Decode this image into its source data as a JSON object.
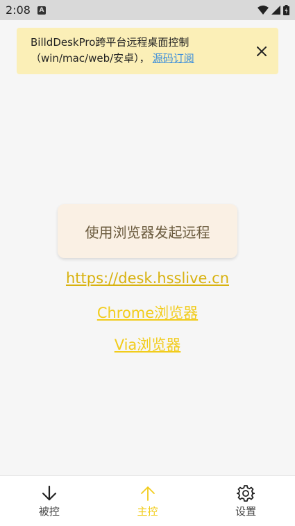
{
  "status_bar": {
    "time": "2:08",
    "app_icon_letter": "A"
  },
  "notice": {
    "text": "BilldDeskPro跨平台远程桌面控制（win/mac/web/安卓），",
    "link_text": "源码订阅"
  },
  "main": {
    "start_button_label": "使用浏览器发起远程",
    "links": [
      "https://desk.hsslive.cn",
      "Chrome浏览器",
      "Via浏览器"
    ]
  },
  "bottom_nav": {
    "items": [
      {
        "label": "被控",
        "icon": "arrow-down-icon"
      },
      {
        "label": "主控",
        "icon": "arrow-up-icon"
      },
      {
        "label": "设置",
        "icon": "gear-icon"
      }
    ],
    "active_index": 1
  },
  "colors": {
    "accent": "#f2cc1b",
    "notice_bg": "#fbefb7",
    "link_blue": "#3c8edb"
  }
}
